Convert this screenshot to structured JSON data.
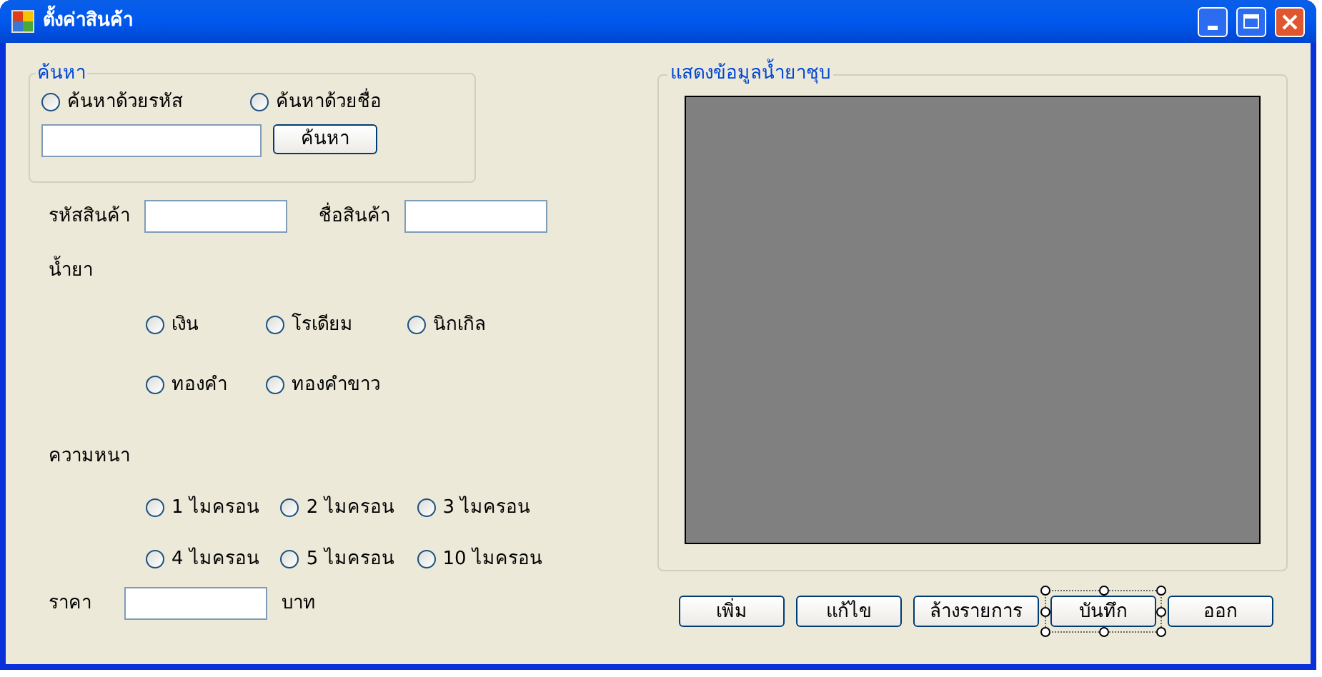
{
  "window": {
    "title": "ตั้งค่าสินค้า"
  },
  "search_group": {
    "title": "ค้นหา",
    "options": [
      {
        "label": "ค้นหาด้วยรหัส",
        "selected": false
      },
      {
        "label": "ค้นหาด้วยชื่อ",
        "selected": false
      }
    ],
    "button": "ค้นหา"
  },
  "fields": [
    {
      "label": "รหัสสินค้า"
    },
    {
      "label": "ชื่อสินค้า"
    }
  ],
  "solution": {
    "label": "น้ำยา",
    "rows": [
      [
        {
          "label": "เงิน",
          "selected": false
        },
        {
          "label": "โรเดียม",
          "selected": false
        },
        {
          "label": "นิกเกิล",
          "selected": false
        }
      ],
      [
        {
          "label": "ทองคำ",
          "selected": false
        },
        {
          "label": "ทองคำขาว",
          "selected": false
        }
      ]
    ]
  },
  "thickness": {
    "label": "ความหนา",
    "rows": [
      [
        {
          "label": "1 ไมครอน",
          "selected": false
        },
        {
          "label": "2 ไมครอน",
          "selected": false
        },
        {
          "label": "3 ไมครอน",
          "selected": false
        }
      ],
      [
        {
          "label": "4 ไมครอน",
          "selected": false
        },
        {
          "label": "5 ไมครอน",
          "selected": false
        },
        {
          "label": "10 ไมครอน",
          "selected": false
        }
      ]
    ]
  },
  "price": {
    "label": "ราคา",
    "unit": "บาท"
  },
  "display_group": {
    "title": "แสดงข้อมูลน้ำยาชุบ"
  },
  "buttons": [
    {
      "label": "เพิ่ม",
      "selected": false
    },
    {
      "label": "แก้ไข",
      "selected": false
    },
    {
      "label": "ล้างรายการ",
      "selected": false
    },
    {
      "label": "บันทึก",
      "selected": true
    },
    {
      "label": "ออก",
      "selected": false
    }
  ]
}
